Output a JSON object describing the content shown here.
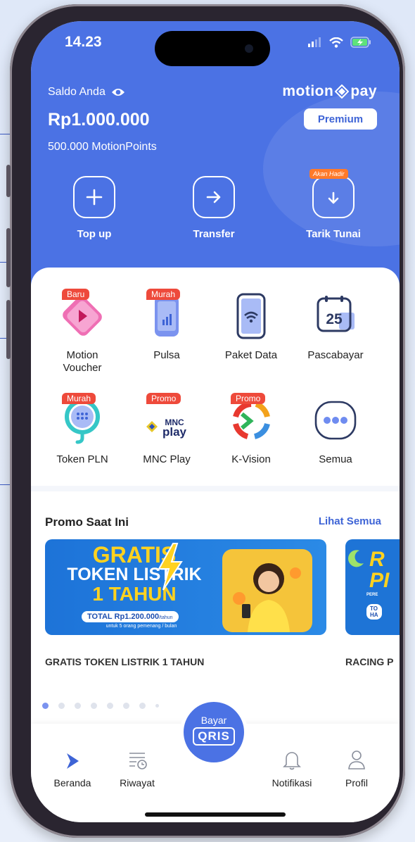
{
  "status_bar": {
    "time": "14.23"
  },
  "header": {
    "balance_label": "Saldo Anda",
    "balance_value": "Rp1.000.000",
    "points": "500.000 MotionPoints",
    "brand_left": "motion",
    "brand_right": "pay",
    "premium_label": "Premium",
    "accent_color": "#4b72e4"
  },
  "actions": [
    {
      "label": "Top up",
      "icon": "plus-icon"
    },
    {
      "label": "Transfer",
      "icon": "arrow-right-icon"
    },
    {
      "label": "Tarik Tunai",
      "icon": "arrow-down-icon",
      "badge": "Akan Hadir"
    }
  ],
  "services": [
    {
      "name": "Motion\nVoucher",
      "tag": "Baru",
      "icon": "voucher-icon"
    },
    {
      "name": "Pulsa",
      "tag": "Murah",
      "icon": "phone-signal-icon"
    },
    {
      "name": "Paket Data",
      "tag": "",
      "icon": "wifi-phone-icon"
    },
    {
      "name": "Pascabayar",
      "tag": "",
      "icon": "calendar-25-icon",
      "day": "25"
    },
    {
      "name": "Token PLN",
      "tag": "Murah",
      "icon": "bulb-icon"
    },
    {
      "name": "MNC Play",
      "tag": "Promo",
      "icon": "mnc-play-logo",
      "logo_top": "MNC",
      "logo_bottom": "play"
    },
    {
      "name": "K-Vision",
      "tag": "Promo",
      "icon": "k-vision-logo"
    },
    {
      "name": "Semua",
      "tag": "",
      "icon": "more-icon"
    }
  ],
  "promo": {
    "title": "Promo Saat Ini",
    "see_all": "Lihat Semua",
    "banner": {
      "line1": "GRATIS",
      "line2": "TOKEN LISTRIK",
      "line3": "1 TAHUN",
      "total": "TOTAL Rp1.200.000",
      "total_unit": "/tahun",
      "note": "untuk 5 orang pemenang / bulan"
    },
    "banner2": {
      "line1": "R",
      "line2": "PI",
      "line3": "PERE",
      "line4": "TO",
      "line5": "HA"
    },
    "captions": [
      "GRATIS TOKEN LISTRIK 1 TAHUN",
      "RACING P"
    ],
    "active_dot": 1,
    "dot_count": 8
  },
  "nav": {
    "items": [
      {
        "label": "Beranda",
        "icon": "home-play-icon"
      },
      {
        "label": "Riwayat",
        "icon": "history-icon"
      },
      {
        "label": "Notifikasi",
        "icon": "bell-icon"
      },
      {
        "label": "Profil",
        "icon": "profile-icon"
      }
    ],
    "qris_top": "Bayar",
    "qris_label": "QRIS"
  }
}
